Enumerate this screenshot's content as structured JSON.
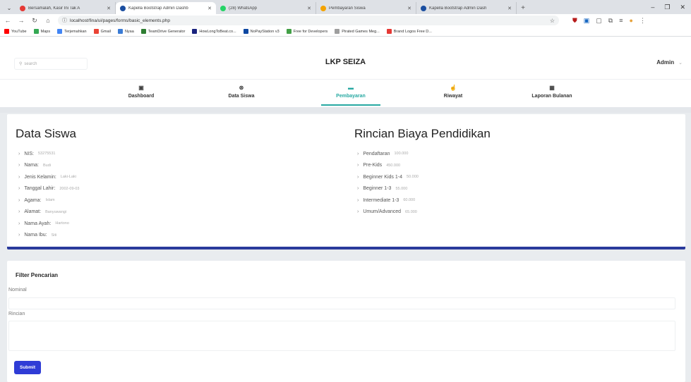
{
  "browser": {
    "tabs": [
      {
        "label": "Bersamalah, Kasir Ini Tak A",
        "color": "#e53935",
        "active": false
      },
      {
        "label": "Kapella Bootstrap Admin Dashb",
        "color": "#1b4ea0",
        "active": true
      },
      {
        "label": "(28) WhatsApp",
        "color": "#25d366",
        "active": false
      },
      {
        "label": "Pembayaran Siswa",
        "color": "#f4a300",
        "active": false
      },
      {
        "label": "Kapella Bootstrap Admin Dash",
        "color": "#1b4ea0",
        "active": false
      }
    ],
    "url": "localhost/fina/ui/pages/forms/basic_elements.php",
    "bookmarks": [
      {
        "label": "YouTube",
        "color": "#ff0000"
      },
      {
        "label": "Maps",
        "color": "#34a853"
      },
      {
        "label": "Terjemahkan",
        "color": "#4285f4"
      },
      {
        "label": "Gmail",
        "color": "#ea4335"
      },
      {
        "label": "Nyaa",
        "color": "#3a7bd5"
      },
      {
        "label": "TeamDrive Generator",
        "color": "#2e7d32"
      },
      {
        "label": "HowLongToBeat.co...",
        "color": "#1a237e"
      },
      {
        "label": "NoPayStation v3",
        "color": "#0d47a1"
      },
      {
        "label": "Free for Developers",
        "color": "#43a047"
      },
      {
        "label": "Pirated Games Meg...",
        "color": "#9e9e9e"
      },
      {
        "label": "Brand Logos Free D...",
        "color": "#e53935"
      }
    ]
  },
  "header": {
    "search_placeholder": "search",
    "brand": "LKP SEIZA",
    "user": "Admin"
  },
  "menu": [
    {
      "label": "Dashboard",
      "icon": "dashboard-icon",
      "active": false
    },
    {
      "label": "Data Siswa",
      "icon": "student-icon",
      "active": false
    },
    {
      "label": "Pembayaran",
      "icon": "payment-icon",
      "active": true
    },
    {
      "label": "Riwayat",
      "icon": "history-icon",
      "active": false
    },
    {
      "label": "Laporan Bulanan",
      "icon": "report-icon",
      "active": false
    }
  ],
  "student": {
    "title": "Data Siswa",
    "fields": [
      {
        "label": "NIS:",
        "value": "53275531"
      },
      {
        "label": "Nama:",
        "value": "Budi"
      },
      {
        "label": "Jenis Kelamin:",
        "value": "Laki-Laki"
      },
      {
        "label": "Tanggal Lahir:",
        "value": "2002-09-03"
      },
      {
        "label": "Agama:",
        "value": "Islam"
      },
      {
        "label": "Alamat:",
        "value": "Banyuwangi"
      },
      {
        "label": "Nama Ayah:",
        "value": "Hartono"
      },
      {
        "label": "Nama Ibu:",
        "value": "Siti"
      }
    ]
  },
  "fees": {
    "title": "Rincian Biaya Pendidikan",
    "items": [
      {
        "label": "Pendaftaran",
        "value": "100.000"
      },
      {
        "label": "Pre-Kids",
        "value": "450.000"
      },
      {
        "label": "Beginner Kids 1-4",
        "value": "50.000"
      },
      {
        "label": "Beginner 1-3",
        "value": "55.000"
      },
      {
        "label": "Intermediate 1-3",
        "value": "60.000"
      },
      {
        "label": "Umum/Advanced",
        "value": "65.000"
      }
    ]
  },
  "form": {
    "title": "Filter Pencarian",
    "nominal_label": "Nominal",
    "rincian_label": "Rincian",
    "submit_label": "Submit"
  },
  "colors": {
    "accent": "#27a9a2",
    "primary": "#2f3cd6",
    "card_bar": "#2a3a9c"
  }
}
